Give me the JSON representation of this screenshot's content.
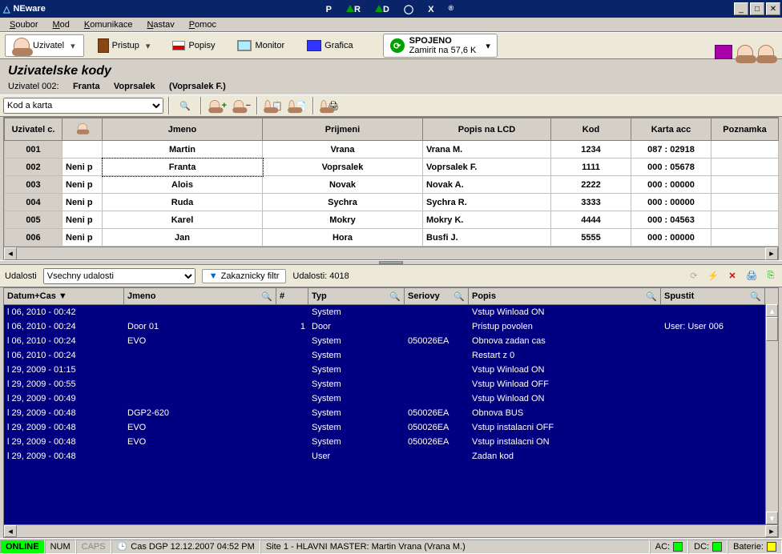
{
  "title": "NEware",
  "brand_letters": [
    "P",
    "A",
    "R",
    "A",
    "D",
    "O",
    "X"
  ],
  "menu": [
    "Soubor",
    "Mod",
    "Komunikace",
    "Nastav",
    "Pomoc"
  ],
  "toolbar": {
    "user": "Uzivatel",
    "access": "Pristup",
    "labels": "Popisy",
    "monitor": "Monitor",
    "grafica": "Grafica"
  },
  "connection": {
    "status": "SPOJENO",
    "detail": "Zamirit na  57,6 K"
  },
  "header": {
    "title": "Uzivatelske kody",
    "user_label": "Uzivatel 002:",
    "first": "Franta",
    "last": "Voprsalek",
    "lcd": "(Voprsalek F.)"
  },
  "filter_label": "Kod a karta",
  "cols": {
    "num": "Uzivatel c.",
    "name": "Jmeno",
    "surname": "Prijmeni",
    "lcd": "Popis na LCD",
    "code": "Kod",
    "card": "Karta acc",
    "note": "Poznamka"
  },
  "rows": [
    {
      "n": "001",
      "p": "",
      "name": "Martin",
      "sur": "Vrana",
      "lcd": "Vrana M.",
      "code": "1234",
      "card": "087 : 02918"
    },
    {
      "n": "002",
      "p": "Neni p",
      "name": "Franta",
      "sur": "Voprsalek",
      "lcd": "Voprsalek F.",
      "code": "1111",
      "card": "000 : 05678"
    },
    {
      "n": "003",
      "p": "Neni p",
      "name": "Alois",
      "sur": "Novak",
      "lcd": "Novak A.",
      "code": "2222",
      "card": "000 : 00000"
    },
    {
      "n": "004",
      "p": "Neni p",
      "name": "Ruda",
      "sur": "Sychra",
      "lcd": "Sychra R.",
      "code": "3333",
      "card": "000 : 00000"
    },
    {
      "n": "005",
      "p": "Neni p",
      "name": "Karel",
      "sur": "Mokry",
      "lcd": "Mokry K.",
      "code": "4444",
      "card": "000 : 04563"
    },
    {
      "n": "006",
      "p": "Neni p",
      "name": "Jan",
      "sur": "Hora",
      "lcd": "Busfi J.",
      "code": "5555",
      "card": "000 : 00000"
    }
  ],
  "events_label": "Udalosti",
  "events_filter": "Vsechny udalosti",
  "custom_filter": "Zakaznicky filtr",
  "events_count": "Udalosti: 4018",
  "ecols": {
    "date": "Datum+Cas",
    "name": "Jmeno",
    "hash": "#",
    "type": "Typ",
    "serial": "Seriovy",
    "desc": "Popis",
    "trigger": "Spustit"
  },
  "events": [
    {
      "d": "l 06, 2010 - 00:42",
      "n": "",
      "h": "",
      "t": "System",
      "s": "",
      "p": "Vstup Winload ON",
      "r": ""
    },
    {
      "d": "l 06, 2010 - 00:24",
      "n": "Door 01",
      "h": "1",
      "t": "Door",
      "s": "",
      "p": "Pristup povolen",
      "r": "User: User 006"
    },
    {
      "d": "l 06, 2010 - 00:24",
      "n": "EVO",
      "h": "",
      "t": "System",
      "s": "050026EA",
      "p": "Obnova zadan cas",
      "r": ""
    },
    {
      "d": "l 06, 2010 - 00:24",
      "n": "",
      "h": "",
      "t": "System",
      "s": "",
      "p": "Restart z 0",
      "r": ""
    },
    {
      "d": "l 29, 2009 - 01:15",
      "n": "",
      "h": "",
      "t": "System",
      "s": "",
      "p": "Vstup Winload ON",
      "r": ""
    },
    {
      "d": "l 29, 2009 - 00:55",
      "n": "",
      "h": "",
      "t": "System",
      "s": "",
      "p": "Vstup Winload OFF",
      "r": ""
    },
    {
      "d": "l 29, 2009 - 00:49",
      "n": "",
      "h": "",
      "t": "System",
      "s": "",
      "p": "Vstup Winload ON",
      "r": ""
    },
    {
      "d": "l 29, 2009 - 00:48",
      "n": "DGP2-620",
      "h": "",
      "t": "System",
      "s": "050026EA",
      "p": "Obnova BUS",
      "r": ""
    },
    {
      "d": "l 29, 2009 - 00:48",
      "n": "EVO",
      "h": "",
      "t": "System",
      "s": "050026EA",
      "p": "Vstup instalacni OFF",
      "r": ""
    },
    {
      "d": "l 29, 2009 - 00:48",
      "n": "EVO",
      "h": "",
      "t": "System",
      "s": "050026EA",
      "p": "Vstup instalacni ON",
      "r": ""
    },
    {
      "d": "l 29, 2009 - 00:48",
      "n": "",
      "h": "",
      "t": "User",
      "s": "",
      "p": "Zadan kod",
      "r": ""
    }
  ],
  "status": {
    "online": "ONLINE",
    "num": "NUM",
    "caps": "CAPS",
    "clock": "Cas DGP 12.12.2007  04:52 PM",
    "site": "Site 1 - HLAVNI MASTER: Martin Vrana (Vrana M.)",
    "ac": "AC:",
    "dc": "DC:",
    "bat": "Baterie:"
  }
}
